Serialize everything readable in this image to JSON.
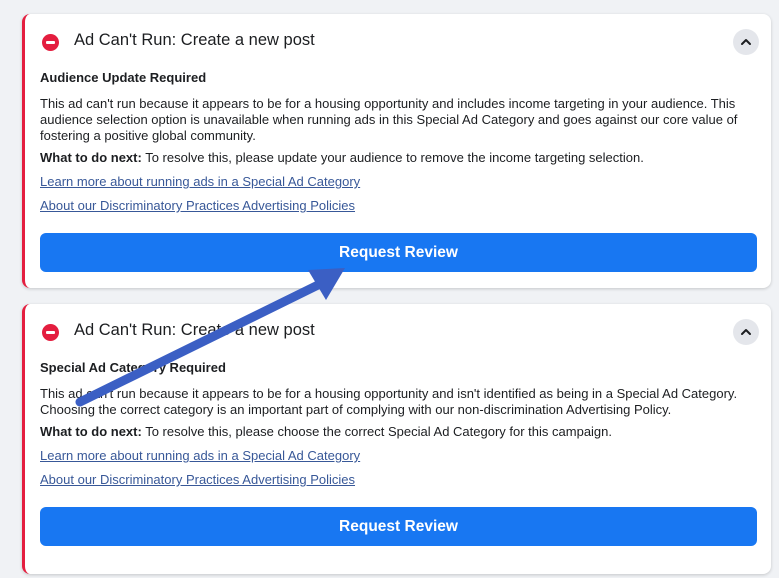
{
  "cards": [
    {
      "title": "Ad Can't Run: Create a new post",
      "subtitle": "Audience Update Required",
      "body": "This ad can't run because it appears to be for a housing opportunity and includes income targeting in your audience. This audience selection option is unavailable when running ads in this Special Ad Category and goes against our core value of fostering a positive global community.",
      "next_label": "What to do next:",
      "next_text": " To resolve this, please update your audience to remove the income targeting selection.",
      "link1": "Learn more about running ads in a Special Ad Category",
      "link2": "About our Discriminatory Practices Advertising Policies",
      "button": "Request Review"
    },
    {
      "title": "Ad Can't Run: Create a new post",
      "subtitle": "Special Ad Category Required",
      "body": "This ad can't run because it appears to be for a housing opportunity and isn't identified as being in a Special Ad Category. Choosing the correct category is an important part of complying with our non-discrimination Advertising Policy.",
      "next_label": "What to do next:",
      "next_text": " To resolve this, please choose the correct Special Ad Category for this campaign.",
      "link1": "Learn more about running ads in a Special Ad Category",
      "link2": "About our Discriminatory Practices Advertising Policies",
      "button": "Request Review"
    }
  ],
  "icons": {
    "error": "error-circle-icon",
    "collapse": "chevron-up-icon",
    "annotation": "annotation-arrow"
  },
  "colors": {
    "error_red": "#e41e3f",
    "button_blue": "#1877f2",
    "link_blue": "#385898",
    "arrow_blue": "#3b5fc4"
  }
}
